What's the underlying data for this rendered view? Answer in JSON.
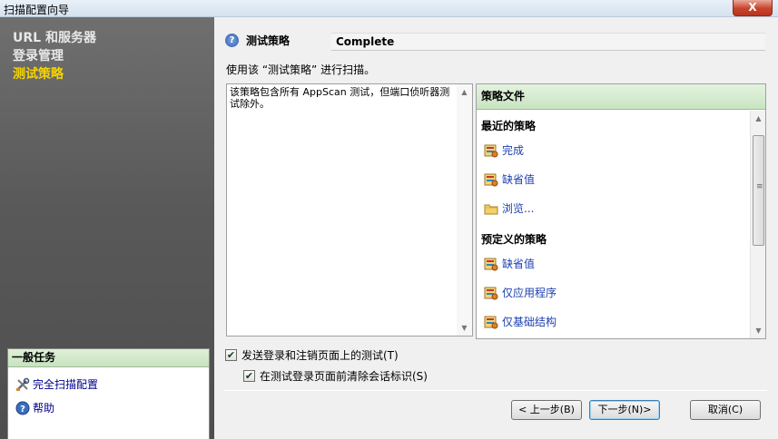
{
  "window": {
    "title": "扫描配置向导",
    "close_label": "X"
  },
  "nav": {
    "items": [
      {
        "label": "URL 和服务器",
        "active": false
      },
      {
        "label": "登录管理",
        "active": false
      },
      {
        "label": "测试策略",
        "active": true
      }
    ]
  },
  "tasks": {
    "header": "一般任务",
    "items": [
      {
        "label": "完全扫描配置",
        "icon": "tools-icon"
      },
      {
        "label": "帮助",
        "icon": "help-icon"
      }
    ]
  },
  "main": {
    "section_label": "测试策略",
    "policy_value": "Complete",
    "instruction": "使用该 “测试策略” 进行扫描。",
    "description": "该策略包含所有 AppScan 测试，但端口侦听器测试除外。"
  },
  "policy_files": {
    "header": "策略文件",
    "recent_label": "最近的策略",
    "recent": [
      "完成",
      "缺省值",
      "浏览..."
    ],
    "predefined_label": "预定义的策略",
    "predefined": [
      "缺省值",
      "仅应用程序",
      "仅基础结构"
    ]
  },
  "options": {
    "send_login_tests": {
      "label": "发送登录和注销页面上的测试(T)",
      "checked": true
    },
    "clear_session_ids": {
      "label": "在测试登录页面前清除会话标识(S)",
      "checked": true
    }
  },
  "buttons": {
    "back": "< 上一步(B)",
    "next": "下一步(N)>",
    "cancel": "取消(C)"
  },
  "colors": {
    "active_nav": "#f5d300",
    "link": "#1b3fae",
    "panel_header": "#c9e4c1"
  }
}
